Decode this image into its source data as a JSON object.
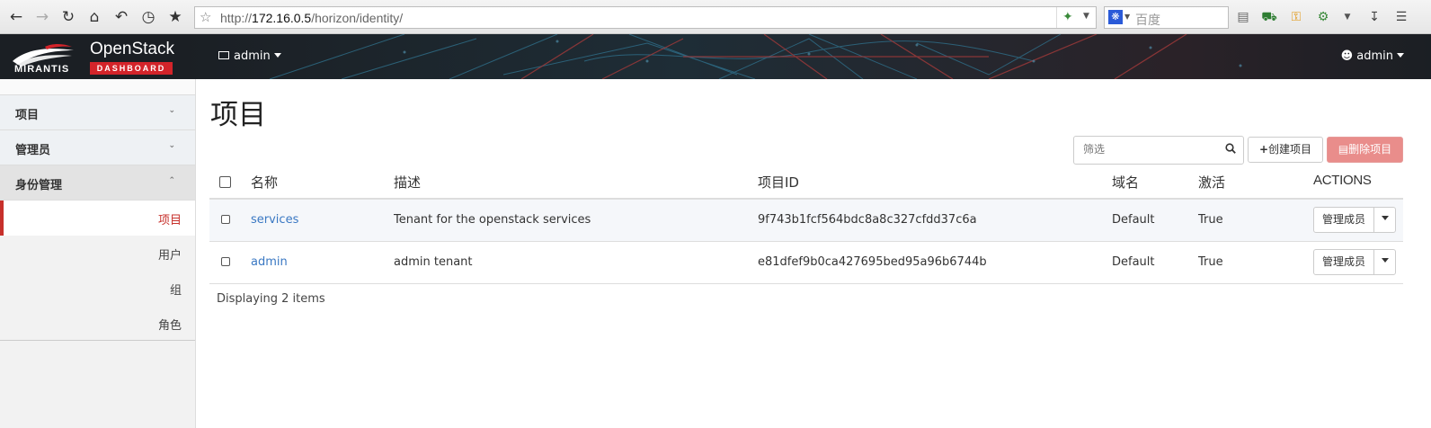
{
  "browser": {
    "url_prefix": "http://",
    "url_host": "172.16.0.5",
    "url_path": "/horizon/identity/",
    "search_placeholder": "百度"
  },
  "header": {
    "brand_small": "MIRANTIS",
    "brand_title": "OpenStack",
    "brand_badge": "DASHBOARD",
    "project_selector": "admin",
    "user_menu": "admin"
  },
  "sidebar": {
    "sections": [
      {
        "label": "项目",
        "state": "collapsed"
      },
      {
        "label": "管理员",
        "state": "collapsed"
      },
      {
        "label": "身份管理",
        "state": "expanded"
      }
    ],
    "items": [
      {
        "label": "项目",
        "active": true
      },
      {
        "label": "用户",
        "active": false
      },
      {
        "label": "组",
        "active": false
      },
      {
        "label": "角色",
        "active": false
      }
    ]
  },
  "main": {
    "title": "项目",
    "filter_placeholder": "筛选",
    "create_button": "创建项目",
    "delete_button": "删除项目",
    "columns": [
      "名称",
      "描述",
      "项目ID",
      "域名",
      "激活",
      "ACTIONS"
    ],
    "rows": [
      {
        "name": "services",
        "description": "Tenant for the openstack services",
        "id": "9f743b1fcf564bdc8a8c327cfdd37c6a",
        "domain": "Default",
        "enabled": "True",
        "action": "管理成员"
      },
      {
        "name": "admin",
        "description": "admin tenant",
        "id": "e81dfef9b0ca427695bed95a96b6744b",
        "domain": "Default",
        "enabled": "True",
        "action": "管理成员"
      }
    ],
    "footer": "Displaying 2 items"
  },
  "colors": {
    "accent_red": "#c7302b",
    "link_blue": "#3a78c3",
    "header_bg": "#1b1f24",
    "delete_button_bg": "#e98d8b"
  }
}
